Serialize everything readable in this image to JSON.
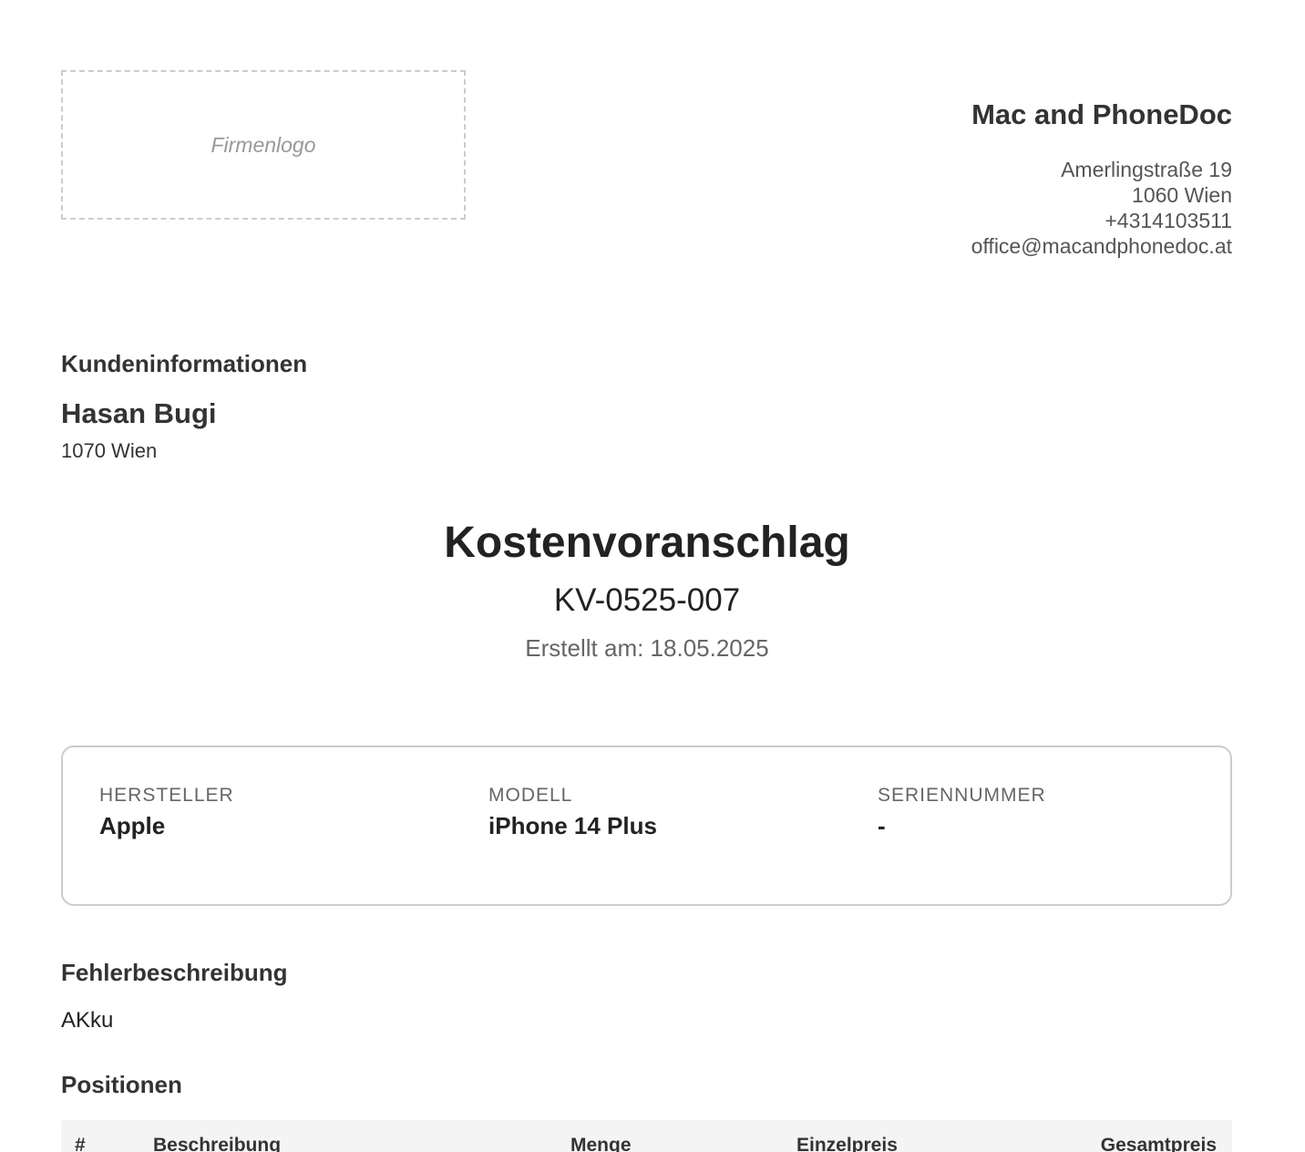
{
  "logo": {
    "placeholder": "Firmenlogo"
  },
  "company": {
    "name": "Mac and PhoneDoc",
    "street": "Amerlingstraße 19",
    "city": "1060 Wien",
    "phone": "+4314103511",
    "email": "office@macandphonedoc.at"
  },
  "customer": {
    "heading": "Kundeninformationen",
    "name": "Hasan Bugi",
    "city": "1070 Wien"
  },
  "document": {
    "title": "Kostenvoranschlag",
    "number": "KV-0525-007",
    "created": "Erstellt am: 18.05.2025"
  },
  "device": {
    "manufacturer_label": "HERSTELLER",
    "manufacturer_value": "Apple",
    "model_label": "MODELL",
    "model_value": "iPhone 14 Plus",
    "serial_label": "SERIENNUMMER",
    "serial_value": "-"
  },
  "fault": {
    "heading": "Fehlerbeschreibung",
    "text": "AKku"
  },
  "positions": {
    "heading": "Positionen",
    "columns": [
      "#",
      "Beschreibung",
      "Menge",
      "Einzelpreis",
      "Gesamtpreis"
    ]
  }
}
